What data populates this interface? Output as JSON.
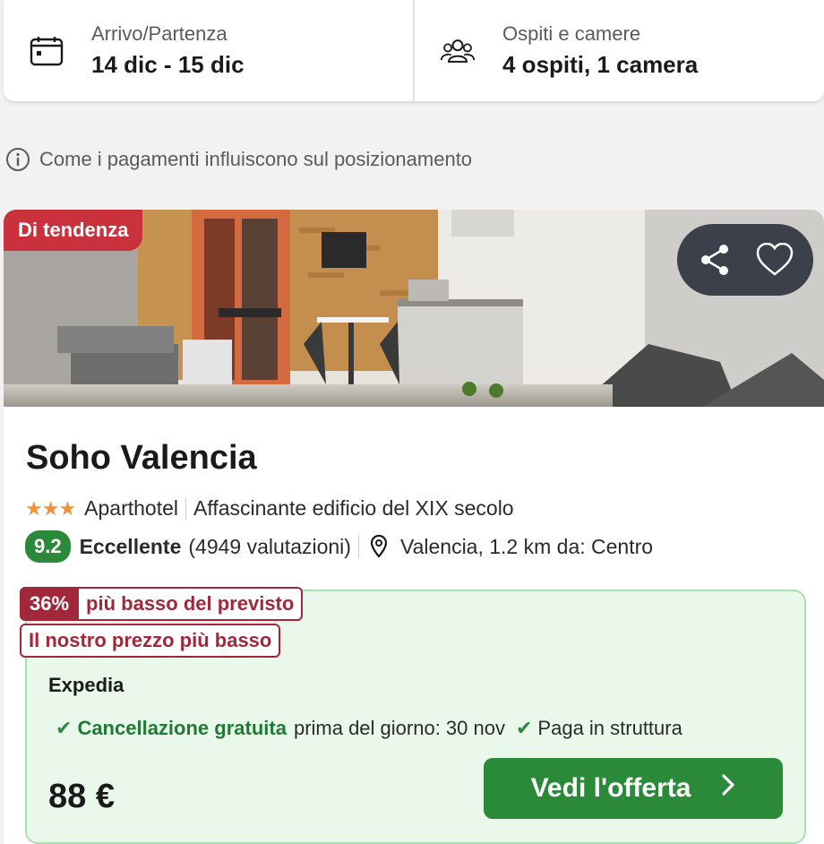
{
  "search": {
    "dates_label": "Arrivo/Partenza",
    "dates_value": "14 dic - 15 dic",
    "guests_label": "Ospiti e camere",
    "guests_value": "4 ospiti, 1 camera"
  },
  "info": {
    "text": "Come i pagamenti influiscono sul posizionamento"
  },
  "card": {
    "badge": "Di tendenza",
    "name": "Soho Valencia",
    "stars": "★★★",
    "type": "Aparthotel",
    "feature": "Affascinante edificio del XIX secolo",
    "score": "9.2",
    "rating_word": "Eccellente",
    "reviews": "(4949 valutazioni)",
    "location": "Valencia, 1.2 km da: Centro",
    "deal_pct": "36%",
    "deal_text": "più basso del previsto",
    "lowest_price": "Il nostro prezzo più basso",
    "provider": "Expedia",
    "perk1_strong": "Cancellazione gratuita",
    "perk1_rest": "prima del giorno: 30 nov",
    "perk2": "Paga in struttura",
    "price": "88 €",
    "cta": "Vedi l'offerta"
  },
  "colors": {
    "badge_red": "#c9323d",
    "deal_red": "#a1283a",
    "green": "#2a8a3a",
    "offer_bg": "#eaf8ec",
    "star": "#f0933a"
  },
  "icons": {
    "dates": "calendar-icon",
    "guests": "people-icon",
    "info": "info-icon",
    "share": "share-icon",
    "favorite": "heart-icon",
    "location": "pin-icon",
    "check": "check-icon",
    "cta": "chevron-right-icon"
  }
}
